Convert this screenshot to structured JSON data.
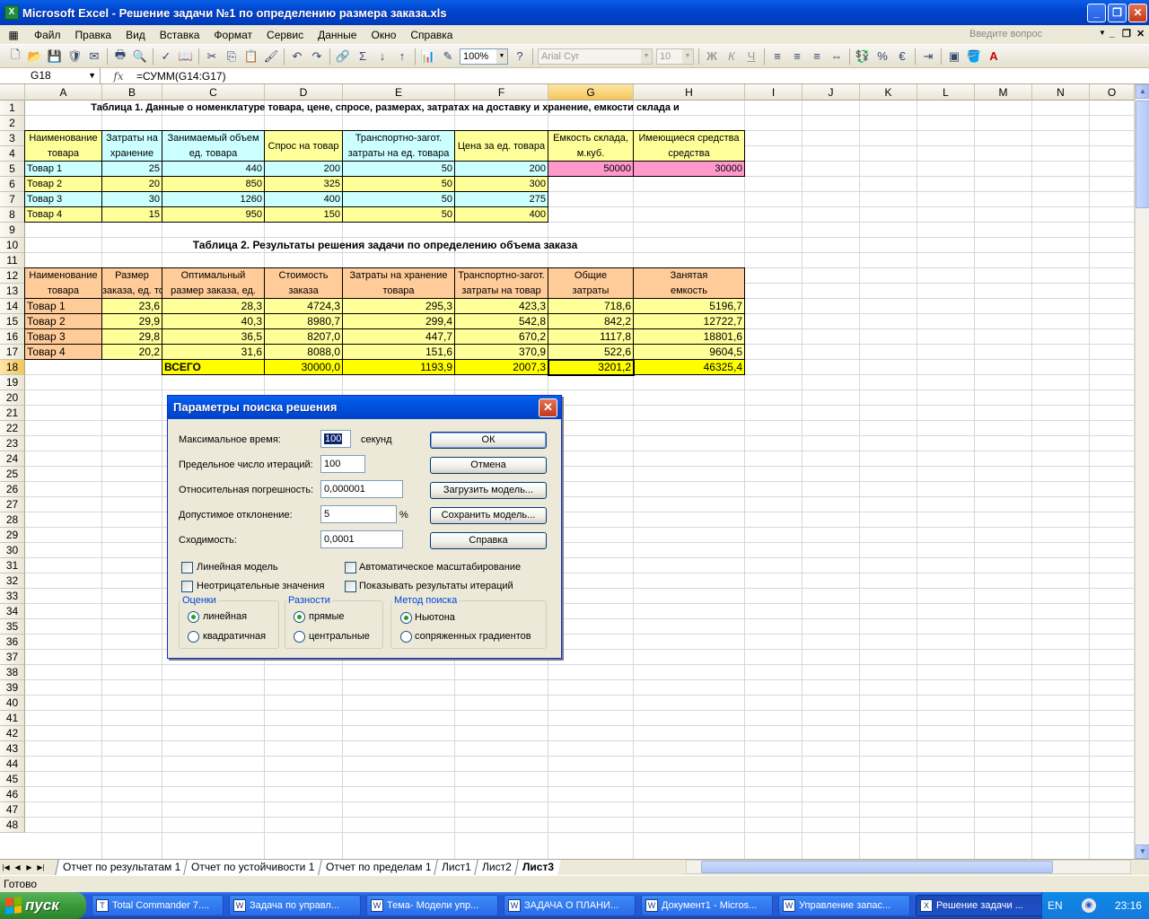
{
  "window": {
    "title": "Microsoft Excel - Решение задачи №1 по определению размера заказа.xls",
    "app_icon": "excel-icon"
  },
  "menu": {
    "items": [
      "Файл",
      "Правка",
      "Вид",
      "Вставка",
      "Формат",
      "Сервис",
      "Данные",
      "Окно",
      "Справка"
    ],
    "help_placeholder": "Введите вопрос"
  },
  "toolbar": {
    "zoom": "100%",
    "font": "Arial Cyr",
    "size": "10",
    "bold": "Ж",
    "italic": "К",
    "underline": "Ч"
  },
  "formula_bar": {
    "cell_ref": "G18",
    "fx": "fx",
    "formula": "=СУММ(G14:G17)"
  },
  "columns": [
    "A",
    "B",
    "C",
    "D",
    "E",
    "F",
    "G",
    "H",
    "I",
    "J",
    "K",
    "L",
    "M",
    "N",
    "O"
  ],
  "rows": [
    "1",
    "2",
    "3",
    "4",
    "5",
    "6",
    "7",
    "8",
    "9",
    "10",
    "11",
    "12",
    "13",
    "14",
    "15",
    "16",
    "17",
    "18",
    "19",
    "20",
    "21",
    "22",
    "23",
    "24",
    "25",
    "26",
    "27",
    "28",
    "29",
    "30",
    "31",
    "32",
    "33",
    "34",
    "35",
    "36",
    "37",
    "38",
    "39",
    "40",
    "41",
    "42",
    "43",
    "44",
    "45",
    "46",
    "47",
    "48"
  ],
  "table1": {
    "title": "Таблица 1. Данные о номенклатуре товара, цене, спросе, размерах, затратах на доставку и хранение, емкости склада и",
    "headers": [
      [
        "Наименование",
        "товара"
      ],
      [
        "Затраты на",
        "хранение",
        "ед. товара"
      ],
      [
        "Занимаемый объем",
        "ед. товара"
      ],
      [
        "Спрос на товар"
      ],
      [
        "Транспортно-загот.",
        "затраты на ед. товара"
      ],
      [
        "Цена за ед. товара"
      ],
      [
        "Емкость склада,",
        "м.куб."
      ],
      [
        "Имеющиеся средства",
        "средства"
      ]
    ],
    "rows": [
      [
        "Товар 1",
        "25",
        "440",
        "200",
        "50",
        "200",
        "50000",
        "30000"
      ],
      [
        "Товар 2",
        "20",
        "850",
        "325",
        "50",
        "300"
      ],
      [
        "Товар 3",
        "30",
        "1260",
        "400",
        "50",
        "275"
      ],
      [
        "Товар 4",
        "15",
        "950",
        "150",
        "50",
        "400"
      ]
    ]
  },
  "table2": {
    "title": "Таблица 2. Результаты решения задачи по определению объема заказа",
    "headers": [
      [
        "Наименование",
        "товара"
      ],
      [
        "Размер",
        "заказа, ед. товара"
      ],
      [
        "Оптимальный",
        "размер заказа, ед."
      ],
      [
        "Стоимость",
        "заказа"
      ],
      [
        "Затраты на хранение",
        "товара"
      ],
      [
        "Транспортно-загот.",
        "затраты на товар"
      ],
      [
        "Общие",
        "затраты"
      ],
      [
        "Занятая",
        "емкость"
      ]
    ],
    "rows": [
      [
        "Товар 1",
        "23,6",
        "28,3",
        "4724,3",
        "295,3",
        "423,3",
        "718,6",
        "5196,7"
      ],
      [
        "Товар 2",
        "29,9",
        "40,3",
        "8980,7",
        "299,4",
        "542,8",
        "842,2",
        "12722,7"
      ],
      [
        "Товар 3",
        "29,8",
        "36,5",
        "8207,0",
        "447,7",
        "670,2",
        "1117,8",
        "18801,6"
      ],
      [
        "Товар 4",
        "20,2",
        "31,6",
        "8088,0",
        "151,6",
        "370,9",
        "522,6",
        "9604,5"
      ]
    ],
    "total": [
      "ВСЕГО",
      "30000,0",
      "1193,9",
      "2007,3",
      "3201,2",
      "46325,4"
    ]
  },
  "dialog": {
    "title": "Параметры поиска решения",
    "max_time_label": "Максимальное время:",
    "max_time_value": "100",
    "max_time_unit": "секунд",
    "iterations_label": "Предельное число итераций:",
    "iterations_value": "100",
    "precision_label": "Относительная погрешность:",
    "precision_value": "0,000001",
    "tolerance_label": "Допустимое отклонение:",
    "tolerance_value": "5",
    "tolerance_unit": "%",
    "convergence_label": "Сходимость:",
    "convergence_value": "0,0001",
    "buttons": {
      "ok": "ОК",
      "cancel": "Отмена",
      "load": "Загрузить модель...",
      "save": "Сохранить модель...",
      "help": "Справка"
    },
    "checkboxes": {
      "linear": "Линейная модель",
      "nonneg": "Неотрицательные значения",
      "autoscale": "Автоматическое масштабирование",
      "show_iter": "Показывать результаты итераций"
    },
    "estimates": {
      "title": "Оценки",
      "opt1": "линейная",
      "opt2": "квадратичная",
      "selected": "линейная"
    },
    "derivatives": {
      "title": "Разности",
      "opt1": "прямые",
      "opt2": "центральные",
      "selected": "прямые"
    },
    "search": {
      "title": "Метод поиска",
      "opt1": "Ньютона",
      "opt2": "сопряженных градиентов",
      "selected": "Ньютона"
    }
  },
  "sheet_tabs": [
    "Отчет по результатам 1",
    "Отчет по устойчивости 1",
    "Отчет по пределам 1",
    "Лист1",
    "Лист2",
    "Лист3"
  ],
  "active_tab": "Лист3",
  "status": "Готово",
  "taskbar": {
    "start": "пуск",
    "tasks": [
      "Total Commander 7....",
      "Задача по управл...",
      "Тема- Модели упр...",
      "ЗАДАЧА О ПЛАНИ...",
      "Документ1 - Micros...",
      "Управление запас...",
      "Решение задачи ..."
    ],
    "active_task": "Решение задачи ...",
    "lang": "EN",
    "clock": "23:16"
  },
  "colors": {
    "cyan": "#ccffff",
    "yellow": "#ffff99",
    "pink": "#ff99cc",
    "orange": "#ffcc99",
    "total_yellow": "#ffff00"
  }
}
